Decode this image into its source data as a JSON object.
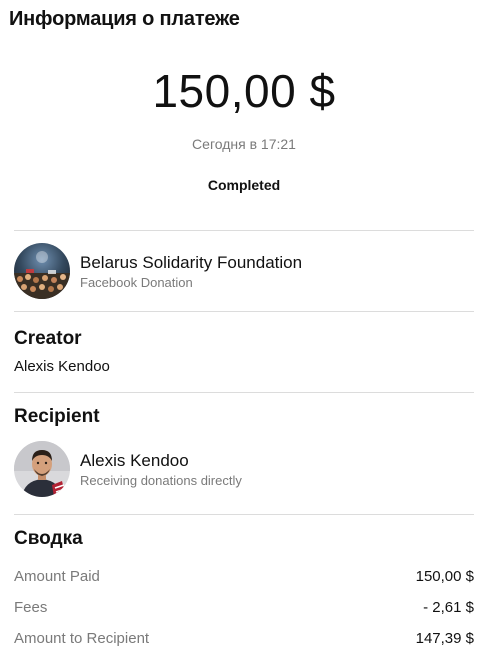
{
  "header": {
    "title": "Информация о платеже"
  },
  "payment": {
    "amount": "150,00 $",
    "timestamp": "Сегодня в 17:21",
    "status": "Completed"
  },
  "fundraiser": {
    "name": "Belarus Solidarity Foundation",
    "subtitle": "Facebook Donation",
    "avatar_icon": "crowd-photo-avatar"
  },
  "creator": {
    "heading": "Creator",
    "name": "Alexis Kendoo"
  },
  "recipient": {
    "heading": "Recipient",
    "name": "Alexis Kendoo",
    "subtitle": "Receiving donations directly",
    "avatar_icon": "person-photo-avatar"
  },
  "summary": {
    "heading": "Сводка",
    "rows": [
      {
        "label": "Amount Paid",
        "value": "150,00 $"
      },
      {
        "label": "Fees",
        "value": "- 2,61 $"
      },
      {
        "label": "Amount to Recipient",
        "value": "147,39 $"
      }
    ]
  },
  "colors": {
    "text": "#111111",
    "secondary_text": "#7a7a7a",
    "divider": "#dcdcdc",
    "background": "#ffffff"
  }
}
